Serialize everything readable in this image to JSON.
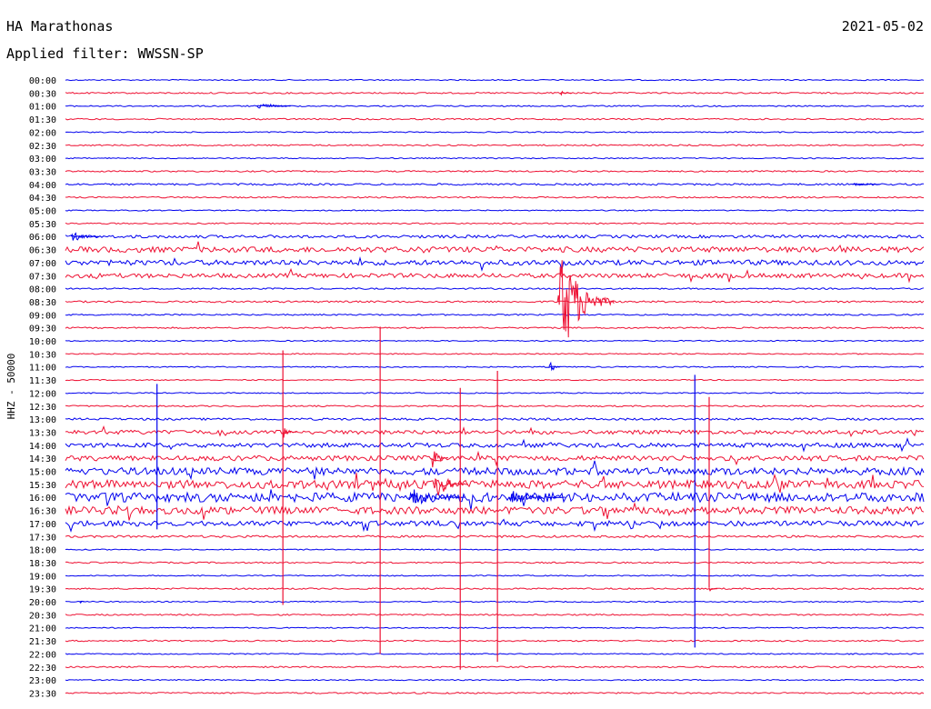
{
  "header": {
    "station": "HA Marathonas",
    "filter": "Applied filter: WWSSN-SP",
    "date": "2021-05-02"
  },
  "chart_data": {
    "type": "line",
    "title": "HA Marathonas",
    "subtitle": "Applied filter: WWSSN-SP",
    "date": "2021-05-02",
    "ylabel": "HHZ - 50000",
    "rows": [
      "00:00",
      "00:30",
      "01:00",
      "01:30",
      "02:00",
      "02:30",
      "03:00",
      "03:30",
      "04:00",
      "04:30",
      "05:00",
      "05:30",
      "06:00",
      "06:30",
      "07:00",
      "07:30",
      "08:00",
      "08:30",
      "09:00",
      "09:30",
      "10:00",
      "10:30",
      "11:00",
      "11:30",
      "12:00",
      "12:30",
      "13:00",
      "13:30",
      "14:00",
      "14:30",
      "15:00",
      "15:30",
      "16:00",
      "16:30",
      "17:00",
      "17:30",
      "18:00",
      "18:30",
      "19:00",
      "19:30",
      "20:00",
      "20:30",
      "21:00",
      "21:30",
      "22:00",
      "22:30",
      "23:00",
      "23:30"
    ],
    "colors": [
      "#0000ee",
      "#ee1133"
    ],
    "row_minutes": 30,
    "noise": [
      0.6,
      0.8,
      0.7,
      0.8,
      0.6,
      0.8,
      0.6,
      0.8,
      1.0,
      0.8,
      0.6,
      0.7,
      1.6,
      3.0,
      2.8,
      2.4,
      0.8,
      1.0,
      0.8,
      0.8,
      0.6,
      0.6,
      0.6,
      0.6,
      0.6,
      0.8,
      1.2,
      2.2,
      2.4,
      2.8,
      4.0,
      4.5,
      5.0,
      4.0,
      2.8,
      1.2,
      0.6,
      0.8,
      0.6,
      0.8,
      0.6,
      0.8,
      0.6,
      0.8,
      0.6,
      0.8,
      0.6,
      0.8
    ],
    "events": [
      {
        "row": "01:00",
        "minute": 6.7,
        "amplitude": 8,
        "duration_min": 1.2
      },
      {
        "row": "00:30",
        "minute": 17.3,
        "amplitude": 3,
        "duration_min": 0.4
      },
      {
        "row": "04:00",
        "minute": 27.5,
        "amplitude": 3,
        "duration_min": 1.0
      },
      {
        "row": "06:00",
        "minute": 0.2,
        "amplitude": 8,
        "duration_min": 1.0
      },
      {
        "row": "08:30",
        "minute": 17.2,
        "amplitude": 80,
        "duration_min": 2.0
      },
      {
        "row": "11:00",
        "minute": 16.9,
        "amplitude": 12,
        "duration_min": 0.4
      },
      {
        "row": "13:30",
        "minute": 7.6,
        "amplitude": 10,
        "duration_min": 0.5
      },
      {
        "row": "14:30",
        "minute": 12.8,
        "amplitude": 20,
        "duration_min": 0.6
      },
      {
        "row": "15:30",
        "minute": 12.9,
        "amplitude": 22,
        "duration_min": 1.2
      },
      {
        "row": "16:00",
        "minute": 12.0,
        "amplitude": 14,
        "duration_min": 2.0
      },
      {
        "row": "16:00",
        "minute": 15.5,
        "amplitude": 12,
        "duration_min": 2.0
      },
      {
        "row": "20:00",
        "minute": 0.5,
        "amplitude": 3,
        "duration_min": 0.2
      },
      {
        "row": "19:30",
        "minute": 22.5,
        "amplitude": 4,
        "duration_min": 0.3
      }
    ],
    "spikes": [
      {
        "row": "13:30",
        "minute": 7.6,
        "up": 90,
        "down": 190
      },
      {
        "row": "10:30",
        "minute": 11.0,
        "up": 30,
        "down": 330
      },
      {
        "row": "12:30",
        "minute": 13.8,
        "up": 20,
        "down": 290
      },
      {
        "row": "11:30",
        "minute": 15.1,
        "up": 10,
        "down": 310
      },
      {
        "row": "12:00",
        "minute": 22.0,
        "up": 20,
        "down": 280
      },
      {
        "row": "12:30",
        "minute": 22.5,
        "up": 10,
        "down": 200
      },
      {
        "row": "12:00",
        "minute": 3.2,
        "up": 10,
        "down": 150
      }
    ]
  }
}
